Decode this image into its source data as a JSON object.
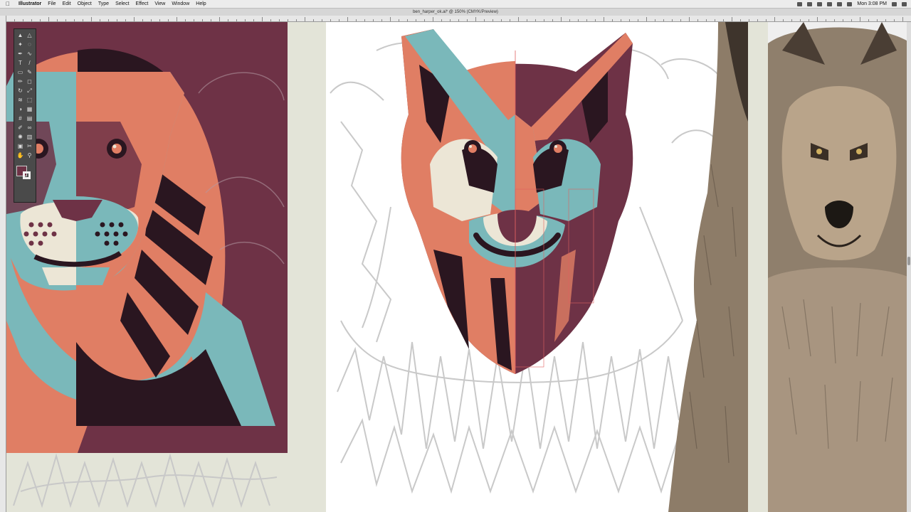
{
  "menubar": {
    "app_name": "Illustrator",
    "items": [
      "File",
      "Edit",
      "Object",
      "Type",
      "Select",
      "Effect",
      "View",
      "Window",
      "Help"
    ],
    "clock": "Mon 3:08 PM"
  },
  "document": {
    "title": "ben_harper_ok.ai* @ 150% (CMYK/Preview)"
  },
  "toolbar": {
    "tools": [
      "selection-tool",
      "direct-selection-tool",
      "magic-wand-tool",
      "lasso-tool",
      "pen-tool",
      "curvature-tool",
      "type-tool",
      "line-tool",
      "rectangle-tool",
      "paintbrush-tool",
      "pencil-tool",
      "eraser-tool",
      "rotate-tool",
      "scale-tool",
      "width-tool",
      "free-transform-tool",
      "shape-builder-tool",
      "perspective-tool",
      "mesh-tool",
      "gradient-tool",
      "eyedropper-tool",
      "blend-tool",
      "symbol-sprayer-tool",
      "graph-tool",
      "artboard-tool",
      "slice-tool",
      "hand-tool",
      "zoom-tool"
    ],
    "fill_color": "#6e3246",
    "stroke_color": "#f0f0f0"
  },
  "colors": {
    "plum": "#6e3246",
    "dark": "#2a1620",
    "salmon": "#e07e64",
    "teal": "#7ab8ba",
    "cream": "#ece6d6",
    "canvas_bg": "#e3e4d8"
  }
}
